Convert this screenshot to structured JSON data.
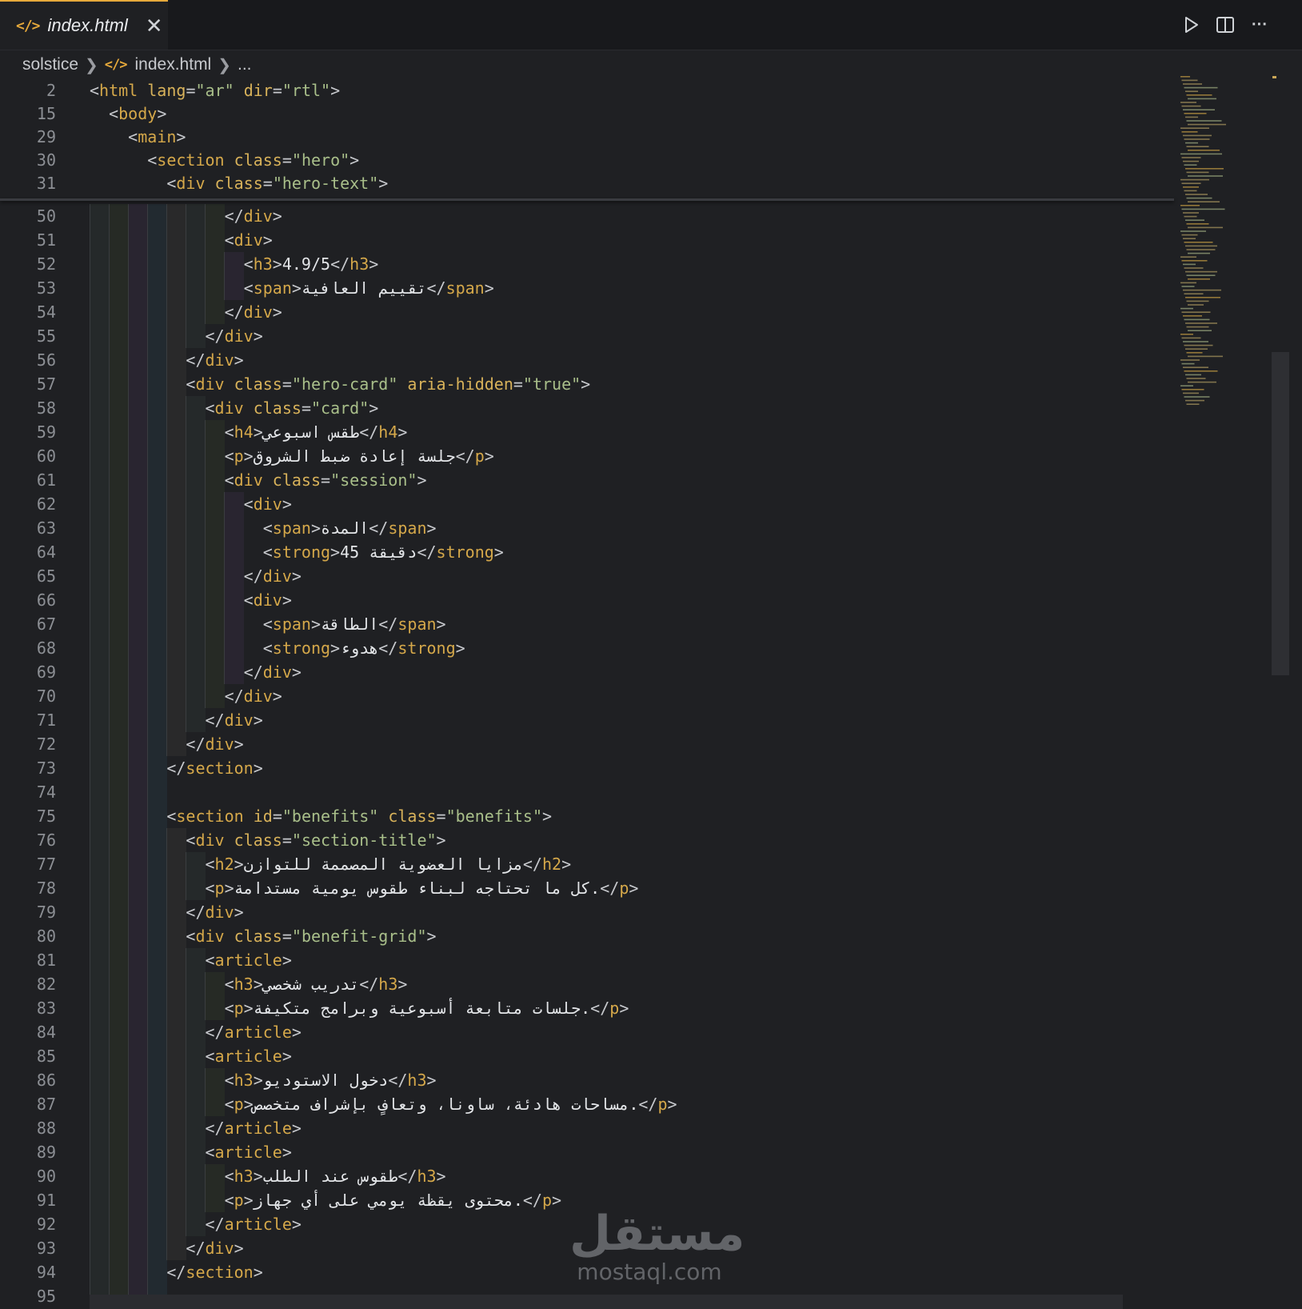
{
  "tab": {
    "icon": "</>",
    "filename": "index.html",
    "close": "✕"
  },
  "toolbar": {
    "run_icon": "play-icon",
    "split_icon": "split-editor-icon",
    "more_label": "···"
  },
  "breadcrumbs": {
    "folder": "solstice",
    "icon": "</>",
    "file": "index.html",
    "more": "..."
  },
  "sticky": [
    {
      "n": "2",
      "html": "<span class=\"p\">&lt;</span><span class=\"t\">html</span> <span class=\"a\">lang</span><span class=\"p\">=</span><span class=\"s\">\"ar\"</span> <span class=\"a\">dir</span><span class=\"p\">=</span><span class=\"s\">\"rtl\"</span><span class=\"p\">&gt;</span>"
    },
    {
      "n": "15",
      "html": "  <span class=\"p\">&lt;</span><span class=\"t\">body</span><span class=\"p\">&gt;</span>"
    },
    {
      "n": "29",
      "html": "    <span class=\"p\">&lt;</span><span class=\"t\">main</span><span class=\"p\">&gt;</span>"
    },
    {
      "n": "30",
      "html": "      <span class=\"p\">&lt;</span><span class=\"t\">section</span> <span class=\"a\">class</span><span class=\"p\">=</span><span class=\"s\">\"hero\"</span><span class=\"p\">&gt;</span>"
    },
    {
      "n": "31",
      "html": "        <span class=\"p\">&lt;</span><span class=\"t\">div</span> <span class=\"a\">class</span><span class=\"p\">=</span><span class=\"s\">\"hero-text\"</span><span class=\"p\">&gt;</span>"
    }
  ],
  "lines": [
    {
      "n": "50",
      "html": "              <span class=\"p\">&lt;/</span><span class=\"t\">div</span><span class=\"p\">&gt;</span>"
    },
    {
      "n": "51",
      "html": "              <span class=\"p\">&lt;</span><span class=\"t\">div</span><span class=\"p\">&gt;</span>"
    },
    {
      "n": "52",
      "html": "                <span class=\"p\">&lt;</span><span class=\"t\">h3</span><span class=\"p\">&gt;</span><span class=\"x\">4.9/5</span><span class=\"p\">&lt;/</span><span class=\"t\">h3</span><span class=\"p\">&gt;</span>"
    },
    {
      "n": "53",
      "html": "                <span class=\"p\">&lt;</span><span class=\"t\">span</span><span class=\"p\">&gt;</span><span class=\"x\">تقييم العافية</span><span class=\"p\">&lt;/</span><span class=\"t\">span</span><span class=\"p\">&gt;</span>"
    },
    {
      "n": "54",
      "html": "              <span class=\"p\">&lt;/</span><span class=\"t\">div</span><span class=\"p\">&gt;</span>"
    },
    {
      "n": "55",
      "html": "            <span class=\"p\">&lt;/</span><span class=\"t\">div</span><span class=\"p\">&gt;</span>"
    },
    {
      "n": "56",
      "html": "          <span class=\"p\">&lt;/</span><span class=\"t\">div</span><span class=\"p\">&gt;</span>"
    },
    {
      "n": "57",
      "html": "          <span class=\"p\">&lt;</span><span class=\"t\">div</span> <span class=\"a\">class</span><span class=\"p\">=</span><span class=\"s\">\"hero-card\"</span> <span class=\"a\">aria-hidden</span><span class=\"p\">=</span><span class=\"s\">\"true\"</span><span class=\"p\">&gt;</span>"
    },
    {
      "n": "58",
      "html": "            <span class=\"p\">&lt;</span><span class=\"t\">div</span> <span class=\"a\">class</span><span class=\"p\">=</span><span class=\"s\">\"card\"</span><span class=\"p\">&gt;</span>"
    },
    {
      "n": "59",
      "html": "              <span class=\"p\">&lt;</span><span class=\"t\">h4</span><span class=\"p\">&gt;</span><span class=\"x\">طقس اسبوعي</span><span class=\"p\">&lt;/</span><span class=\"t\">h4</span><span class=\"p\">&gt;</span>"
    },
    {
      "n": "60",
      "html": "              <span class=\"p\">&lt;</span><span class=\"t\">p</span><span class=\"p\">&gt;</span><span class=\"x\">جلسة إعادة ضبط الشروق</span><span class=\"p\">&lt;/</span><span class=\"t\">p</span><span class=\"p\">&gt;</span>"
    },
    {
      "n": "61",
      "html": "              <span class=\"p\">&lt;</span><span class=\"t\">div</span> <span class=\"a\">class</span><span class=\"p\">=</span><span class=\"s\">\"session\"</span><span class=\"p\">&gt;</span>"
    },
    {
      "n": "62",
      "html": "                <span class=\"p\">&lt;</span><span class=\"t\">div</span><span class=\"p\">&gt;</span>"
    },
    {
      "n": "63",
      "html": "                  <span class=\"p\">&lt;</span><span class=\"t\">span</span><span class=\"p\">&gt;</span><span class=\"x\">المدة</span><span class=\"p\">&lt;/</span><span class=\"t\">span</span><span class=\"p\">&gt;</span>"
    },
    {
      "n": "64",
      "html": "                  <span class=\"p\">&lt;</span><span class=\"t\">strong</span><span class=\"p\">&gt;</span><span class=\"x\">45 دقيقة</span><span class=\"p\">&lt;/</span><span class=\"t\">strong</span><span class=\"p\">&gt;</span>"
    },
    {
      "n": "65",
      "html": "                <span class=\"p\">&lt;/</span><span class=\"t\">div</span><span class=\"p\">&gt;</span>"
    },
    {
      "n": "66",
      "html": "                <span class=\"p\">&lt;</span><span class=\"t\">div</span><span class=\"p\">&gt;</span>"
    },
    {
      "n": "67",
      "html": "                  <span class=\"p\">&lt;</span><span class=\"t\">span</span><span class=\"p\">&gt;</span><span class=\"x\">الطاقة</span><span class=\"p\">&lt;/</span><span class=\"t\">span</span><span class=\"p\">&gt;</span>"
    },
    {
      "n": "68",
      "html": "                  <span class=\"p\">&lt;</span><span class=\"t\">strong</span><span class=\"p\">&gt;</span><span class=\"x\">هدوء</span><span class=\"p\">&lt;/</span><span class=\"t\">strong</span><span class=\"p\">&gt;</span>"
    },
    {
      "n": "69",
      "html": "                <span class=\"p\">&lt;/</span><span class=\"t\">div</span><span class=\"p\">&gt;</span>"
    },
    {
      "n": "70",
      "html": "              <span class=\"p\">&lt;/</span><span class=\"t\">div</span><span class=\"p\">&gt;</span>"
    },
    {
      "n": "71",
      "html": "            <span class=\"p\">&lt;/</span><span class=\"t\">div</span><span class=\"p\">&gt;</span>"
    },
    {
      "n": "72",
      "html": "          <span class=\"p\">&lt;/</span><span class=\"t\">div</span><span class=\"p\">&gt;</span>"
    },
    {
      "n": "73",
      "html": "        <span class=\"p\">&lt;/</span><span class=\"t\">section</span><span class=\"p\">&gt;</span>"
    },
    {
      "n": "74",
      "html": ""
    },
    {
      "n": "75",
      "html": "        <span class=\"p\">&lt;</span><span class=\"t\">section</span> <span class=\"a\">id</span><span class=\"p\">=</span><span class=\"s\">\"benefits\"</span> <span class=\"a\">class</span><span class=\"p\">=</span><span class=\"s\">\"benefits\"</span><span class=\"p\">&gt;</span>"
    },
    {
      "n": "76",
      "html": "          <span class=\"p\">&lt;</span><span class=\"t\">div</span> <span class=\"a\">class</span><span class=\"p\">=</span><span class=\"s\">\"section-title\"</span><span class=\"p\">&gt;</span>"
    },
    {
      "n": "77",
      "html": "            <span class=\"p\">&lt;</span><span class=\"t\">h2</span><span class=\"p\">&gt;</span><span class=\"x\">مزايا العضوية المصممة للتوازن</span><span class=\"p\">&lt;/</span><span class=\"t\">h2</span><span class=\"p\">&gt;</span>"
    },
    {
      "n": "78",
      "html": "            <span class=\"p\">&lt;</span><span class=\"t\">p</span><span class=\"p\">&gt;</span><span class=\"x\">كل ما تحتاجه لبناء طقوس يومية مستدامة.</span><span class=\"p\">&lt;/</span><span class=\"t\">p</span><span class=\"p\">&gt;</span>"
    },
    {
      "n": "79",
      "html": "          <span class=\"p\">&lt;/</span><span class=\"t\">div</span><span class=\"p\">&gt;</span>"
    },
    {
      "n": "80",
      "html": "          <span class=\"p\">&lt;</span><span class=\"t\">div</span> <span class=\"a\">class</span><span class=\"p\">=</span><span class=\"s\">\"benefit-grid\"</span><span class=\"p\">&gt;</span>"
    },
    {
      "n": "81",
      "html": "            <span class=\"p\">&lt;</span><span class=\"t\">article</span><span class=\"p\">&gt;</span>"
    },
    {
      "n": "82",
      "html": "              <span class=\"p\">&lt;</span><span class=\"t\">h3</span><span class=\"p\">&gt;</span><span class=\"x\">تدريب شخصي</span><span class=\"p\">&lt;/</span><span class=\"t\">h3</span><span class=\"p\">&gt;</span>"
    },
    {
      "n": "83",
      "html": "              <span class=\"p\">&lt;</span><span class=\"t\">p</span><span class=\"p\">&gt;</span><span class=\"x\">جلسات متابعة أسبوعية وبرامج متكيفة.</span><span class=\"p\">&lt;/</span><span class=\"t\">p</span><span class=\"p\">&gt;</span>"
    },
    {
      "n": "84",
      "html": "            <span class=\"p\">&lt;/</span><span class=\"t\">article</span><span class=\"p\">&gt;</span>"
    },
    {
      "n": "85",
      "html": "            <span class=\"p\">&lt;</span><span class=\"t\">article</span><span class=\"p\">&gt;</span>"
    },
    {
      "n": "86",
      "html": "              <span class=\"p\">&lt;</span><span class=\"t\">h3</span><span class=\"p\">&gt;</span><span class=\"x\">دخول الاستوديو</span><span class=\"p\">&lt;/</span><span class=\"t\">h3</span><span class=\"p\">&gt;</span>"
    },
    {
      "n": "87",
      "html": "              <span class=\"p\">&lt;</span><span class=\"t\">p</span><span class=\"p\">&gt;</span><span class=\"x\">مساحات هادئة، ساونا، وتعافٍ بإشراف متخصص.</span><span class=\"p\">&lt;/</span><span class=\"t\">p</span><span class=\"p\">&gt;</span>"
    },
    {
      "n": "88",
      "html": "            <span class=\"p\">&lt;/</span><span class=\"t\">article</span><span class=\"p\">&gt;</span>"
    },
    {
      "n": "89",
      "html": "            <span class=\"p\">&lt;</span><span class=\"t\">article</span><span class=\"p\">&gt;</span>"
    },
    {
      "n": "90",
      "html": "              <span class=\"p\">&lt;</span><span class=\"t\">h3</span><span class=\"p\">&gt;</span><span class=\"x\">طقوس عند الطلب</span><span class=\"p\">&lt;/</span><span class=\"t\">h3</span><span class=\"p\">&gt;</span>"
    },
    {
      "n": "91",
      "html": "              <span class=\"p\">&lt;</span><span class=\"t\">p</span><span class=\"p\">&gt;</span><span class=\"x\">محتوى يقظة يومي على أي جهاز.</span><span class=\"p\">&lt;/</span><span class=\"t\">p</span><span class=\"p\">&gt;</span>"
    },
    {
      "n": "92",
      "html": "            <span class=\"p\">&lt;/</span><span class=\"t\">article</span><span class=\"p\">&gt;</span>"
    },
    {
      "n": "93",
      "html": "          <span class=\"p\">&lt;/</span><span class=\"t\">div</span><span class=\"p\">&gt;</span>"
    },
    {
      "n": "94",
      "html": "        <span class=\"p\">&lt;/</span><span class=\"t\">section</span><span class=\"p\">&gt;</span>"
    },
    {
      "n": "95",
      "html": ""
    }
  ],
  "watermark": {
    "arabic": "مستقل",
    "latin": "mostaql.com"
  }
}
